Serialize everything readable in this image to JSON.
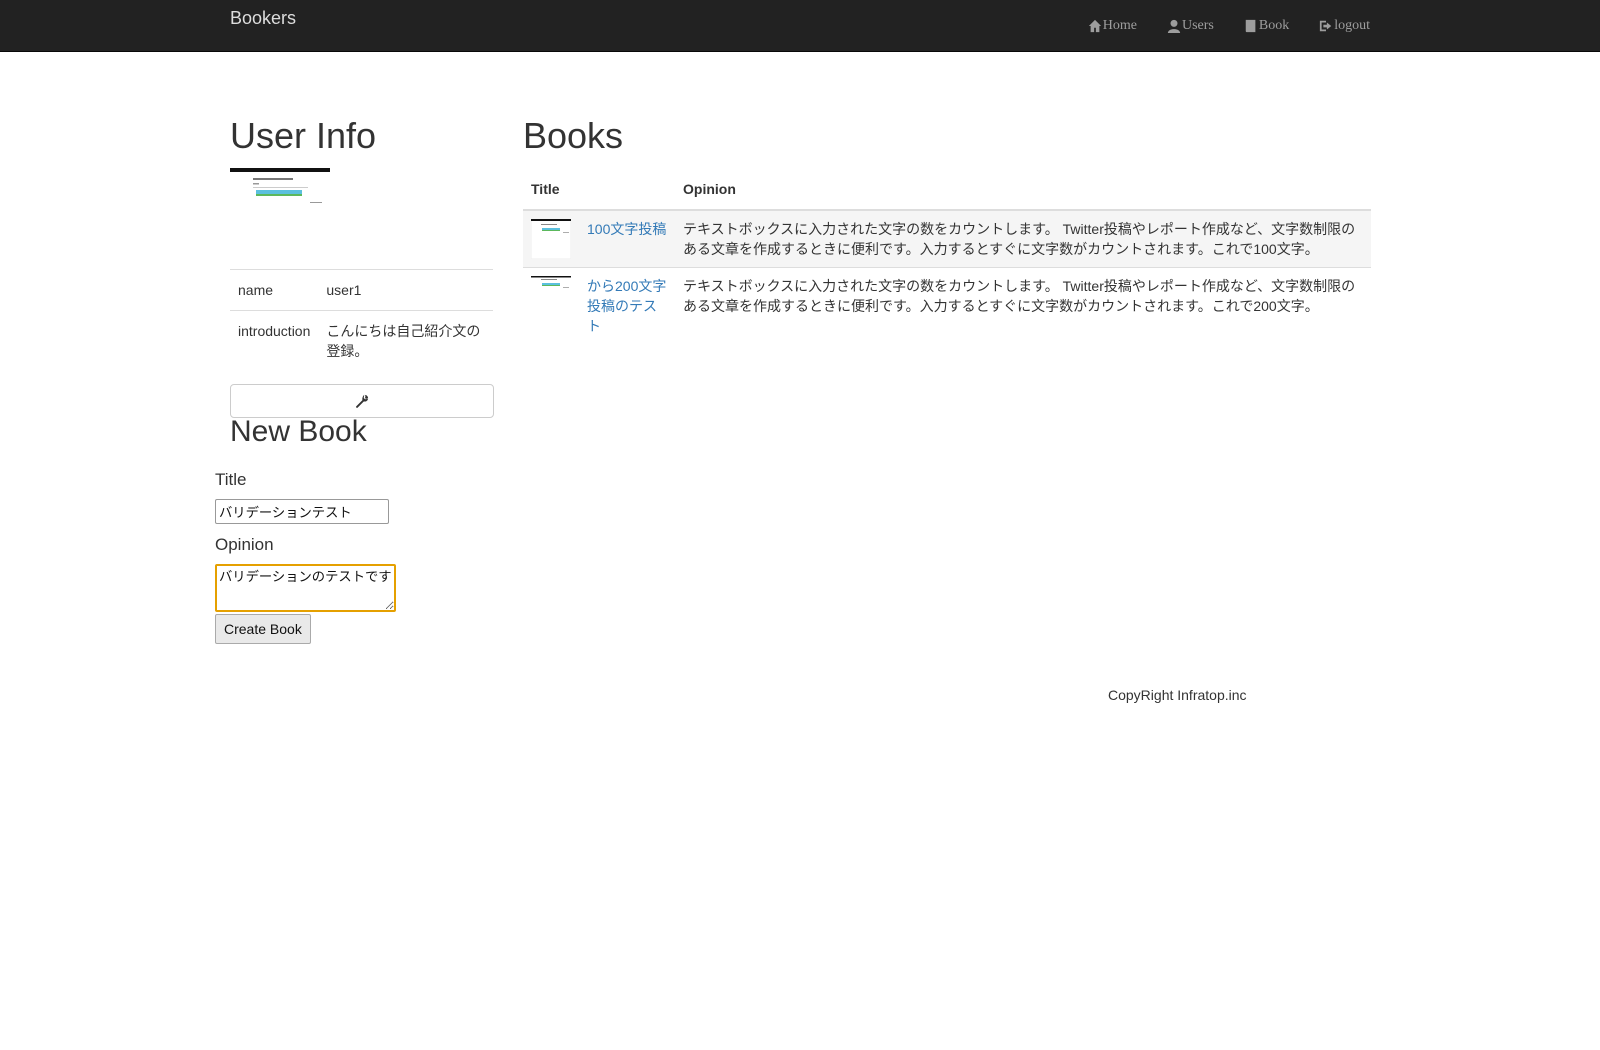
{
  "nav": {
    "brand": "Bookers",
    "links": [
      {
        "label": "Home",
        "icon": "home-icon"
      },
      {
        "label": "Users",
        "icon": "user-icon"
      },
      {
        "label": "Book",
        "icon": "book-icon"
      },
      {
        "label": "logout",
        "icon": "logout-icon"
      }
    ]
  },
  "user_info": {
    "heading": "User Info",
    "rows": [
      {
        "key": "name",
        "value": "user1"
      },
      {
        "key": "introduction",
        "value": "こんにちは自己紹介文の登録。"
      }
    ],
    "edit_icon": "wrench-icon"
  },
  "new_book": {
    "heading": "New Book",
    "title_label": "Title",
    "title_value": "バリデーションテスト",
    "opinion_label": "Opinion",
    "opinion_value": "バリデーションのテストです",
    "submit_label": "Create Book"
  },
  "books": {
    "heading": "Books",
    "columns": [
      "",
      "Title",
      "Opinion"
    ],
    "rows": [
      {
        "title": "100文字投稿",
        "opinion": "テキストボックスに入力された文字の数をカウントします。 Twitter投稿やレポート作成など、文字数制限のある文章を作成するときに便利です。入力するとすぐに文字数がカウントされます。これで100文字。"
      },
      {
        "title": "から200文字投稿のテスト",
        "opinion": "テキストボックスに入力された文字の数をカウントします。 Twitter投稿やレポート作成など、文字数制限のある文章を作成するときに便利です。入力するとすぐに文字数がカウントされます。これで200文字。"
      }
    ]
  },
  "footer": {
    "text": "CopyRight Infratop.inc"
  },
  "colors": {
    "navbar": "#222222",
    "link": "#337ab7",
    "focus_border": "#e5a000"
  }
}
